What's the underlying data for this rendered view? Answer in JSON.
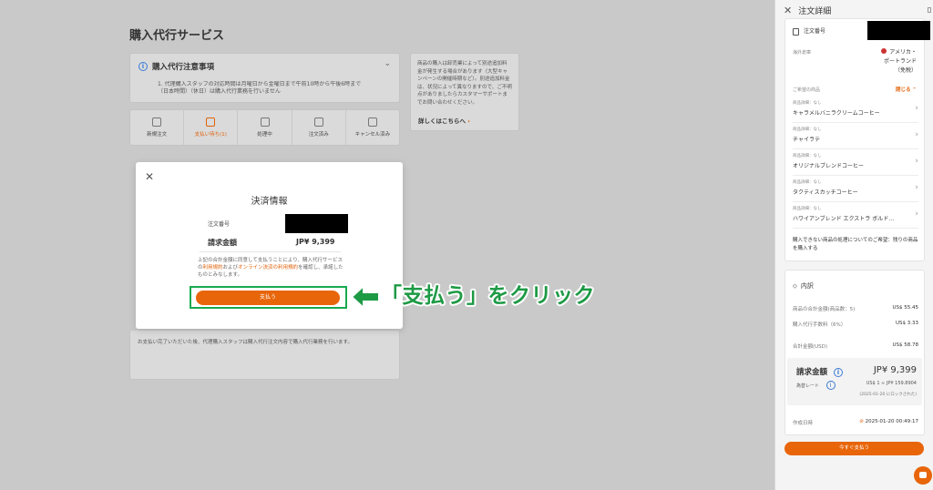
{
  "page": {
    "title": "購入代行サービス",
    "notice_title": "購入代行注意事項",
    "notice_body": "1. 代理購入スタッフの対応時間は月曜日から金曜日まで午前10時から午後6時まで（日本時間）（休日）は購入代行業務を行いません",
    "tabs": [
      {
        "label": "新規注文"
      },
      {
        "label": "支払い待ち(1)"
      },
      {
        "label": "処理中"
      },
      {
        "label": "注文済み"
      },
      {
        "label": "キャンセル済み"
      }
    ],
    "promo_text": "商品の購入は卸売業によって別途追加料金が発生する場合があります（大型キャンペーンの開催時期など）。別途追加料金は、状況によって異なりますので、ご不明点がありましたらカスタマーサポートまでお問い合わせください。",
    "promo_link": "詳しくはこちらへ",
    "bottom_note": "お支払い完了いただいた後、代理購入スタッフは購入代行注文内容で購入代行業務を行います。"
  },
  "modal": {
    "title": "決済情報",
    "order_no_label": "注文番号",
    "amount_label": "請求金額",
    "amount_value": "JP¥ 9,399",
    "legal_1": "上記の合計金額に同意して支払うことにより、購入代行サービスの",
    "legal_link1": "利用規約",
    "legal_2": "および",
    "legal_link2": "オンライン決済の利用規約",
    "legal_3": "を確認し、承諾したものとみなします。",
    "pay_label": "支払う"
  },
  "annotation": {
    "callout": "「支払う」をクリック"
  },
  "drawer": {
    "title": "注文詳細",
    "order_no_label": "注文番号",
    "region_label": "海外倉庫",
    "region_value_1": "アメリカ・",
    "region_value_2": "ポートランド",
    "region_value_3": "（免税）",
    "products_label": "ご希望の商品",
    "collapse_label": "閉じる",
    "product_meta": "商品詳細：なし",
    "products": [
      {
        "name": "キャラメルバニラクリームコーヒー"
      },
      {
        "name": "チャイラテ"
      },
      {
        "name": "オリジナルブレンドコーヒー"
      },
      {
        "name": "タクティスカッチコーヒー"
      },
      {
        "name": "ハワイアンブレンド エクストラ ボルド…"
      }
    ],
    "handling_text": "購入できない商品の処理についてのご希望：残りの商品を購入する",
    "breakdown_title": "内訳",
    "rows": [
      {
        "label": "商品の合計金額(商品数：5)",
        "value": "US$ 55.45"
      },
      {
        "label": "購入代行手数料（6%）",
        "value": "US$ 3.33"
      },
      {
        "label": "合計金額(USD)",
        "value": "US$ 58.78"
      }
    ],
    "total_label": "請求金額",
    "total_value": "JP¥ 9,399",
    "rate_label": "為替レート",
    "rate_value": "US$ 1 ≈ JP¥ 159.8904",
    "rate_locked": "(2025-01-20 にロックされた)",
    "created_label": "作成日時",
    "created_value": "2025-01-20 00:49:17",
    "pay_now_label": "今すぐ支払う"
  },
  "colors": {
    "accent": "#e8650a",
    "annotation_green": "#1e9a45"
  }
}
